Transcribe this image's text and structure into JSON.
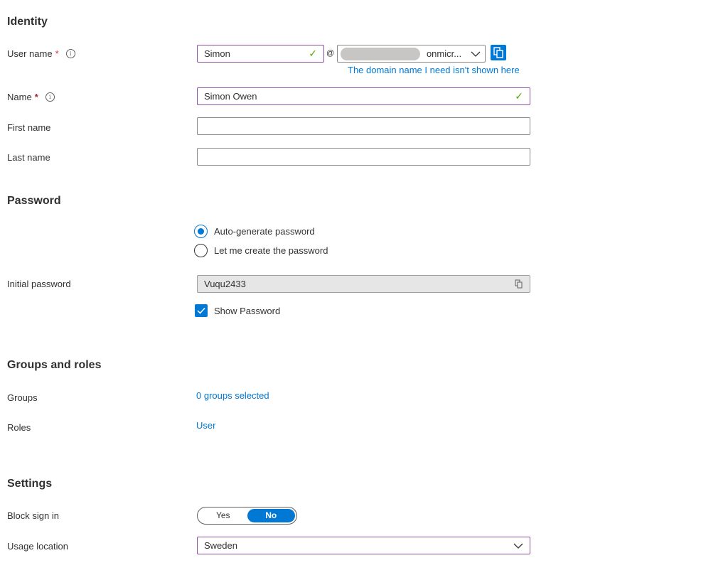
{
  "sections": {
    "identity": "Identity",
    "password": "Password",
    "groups_roles": "Groups and roles",
    "settings": "Settings"
  },
  "identity": {
    "user_name_label": "User name",
    "user_name_value": "Simon",
    "at": "@",
    "domain_value": "onmicr...",
    "domain_link": "The domain name I need isn't shown here",
    "name_label": "Name",
    "name_value": "Simon Owen",
    "first_name_label": "First name",
    "first_name_value": "",
    "last_name_label": "Last name",
    "last_name_value": ""
  },
  "password": {
    "option_auto": "Auto-generate password",
    "option_manual": "Let me create the password",
    "selected": "auto",
    "initial_label": "Initial password",
    "initial_value": "Vuqu2433",
    "show_password_label": "Show Password",
    "show_password_checked": true
  },
  "groups_roles": {
    "groups_label": "Groups",
    "groups_value": "0 groups selected",
    "roles_label": "Roles",
    "roles_value": "User"
  },
  "settings": {
    "block_label": "Block sign in",
    "toggle_yes": "Yes",
    "toggle_no": "No",
    "block_selected": "No",
    "usage_label": "Usage location",
    "usage_value": "Sweden"
  },
  "icons": {
    "required": "*",
    "info": "i",
    "valid": "✓",
    "chevron": "chevron-down-icon",
    "copy": "copy-icon"
  },
  "colors": {
    "accent": "#0078d4",
    "valid": "#57a300",
    "required": "#a4262c"
  }
}
